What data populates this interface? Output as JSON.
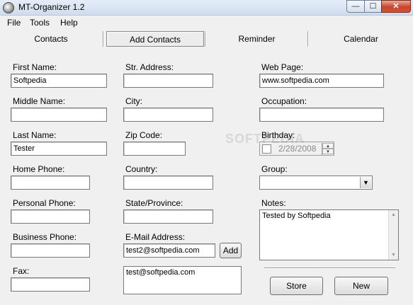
{
  "window": {
    "title": "MT-Organizer 1.2"
  },
  "titlebar": {
    "minimize": "—",
    "maximize": "☐",
    "close": "✕"
  },
  "menu": {
    "file": "File",
    "tools": "Tools",
    "help": "Help"
  },
  "tabs": [
    {
      "label": "Contacts"
    },
    {
      "label": "Add Contacts"
    },
    {
      "label": "Reminder"
    },
    {
      "label": "Calendar"
    }
  ],
  "form": {
    "first_name": {
      "label": "First Name:",
      "value": "Softpedia"
    },
    "middle_name": {
      "label": "Middle Name:",
      "value": ""
    },
    "last_name": {
      "label": "Last Name:",
      "value": "Tester"
    },
    "home_phone": {
      "label": "Home Phone:",
      "value": ""
    },
    "personal_phone": {
      "label": "Personal Phone:",
      "value": ""
    },
    "business_phone": {
      "label": "Business Phone:",
      "value": ""
    },
    "fax": {
      "label": "Fax:",
      "value": ""
    },
    "street": {
      "label": "Str. Address:",
      "value": ""
    },
    "city": {
      "label": "City:",
      "value": ""
    },
    "zip": {
      "label": "Zip Code:",
      "value": ""
    },
    "country": {
      "label": "Country:",
      "value": ""
    },
    "state": {
      "label": "State/Province:",
      "value": ""
    },
    "email": {
      "label": "E-Mail Address:",
      "value": "test2@softpedia.com",
      "add_button": "Add",
      "list": [
        "test@softpedia.com"
      ]
    },
    "web_page": {
      "label": "Web Page:",
      "value": "www.softpedia.com"
    },
    "occupation": {
      "label": "Occupation:",
      "value": ""
    },
    "birthday": {
      "label": "Birthday:",
      "value": "2/28/2008"
    },
    "group": {
      "label": "Group:",
      "value": ""
    },
    "notes": {
      "label": "Notes:",
      "value": "Tested by Softpedia"
    }
  },
  "actions": {
    "store": "Store",
    "new": "New"
  },
  "watermark": "SOFTPEDIA"
}
